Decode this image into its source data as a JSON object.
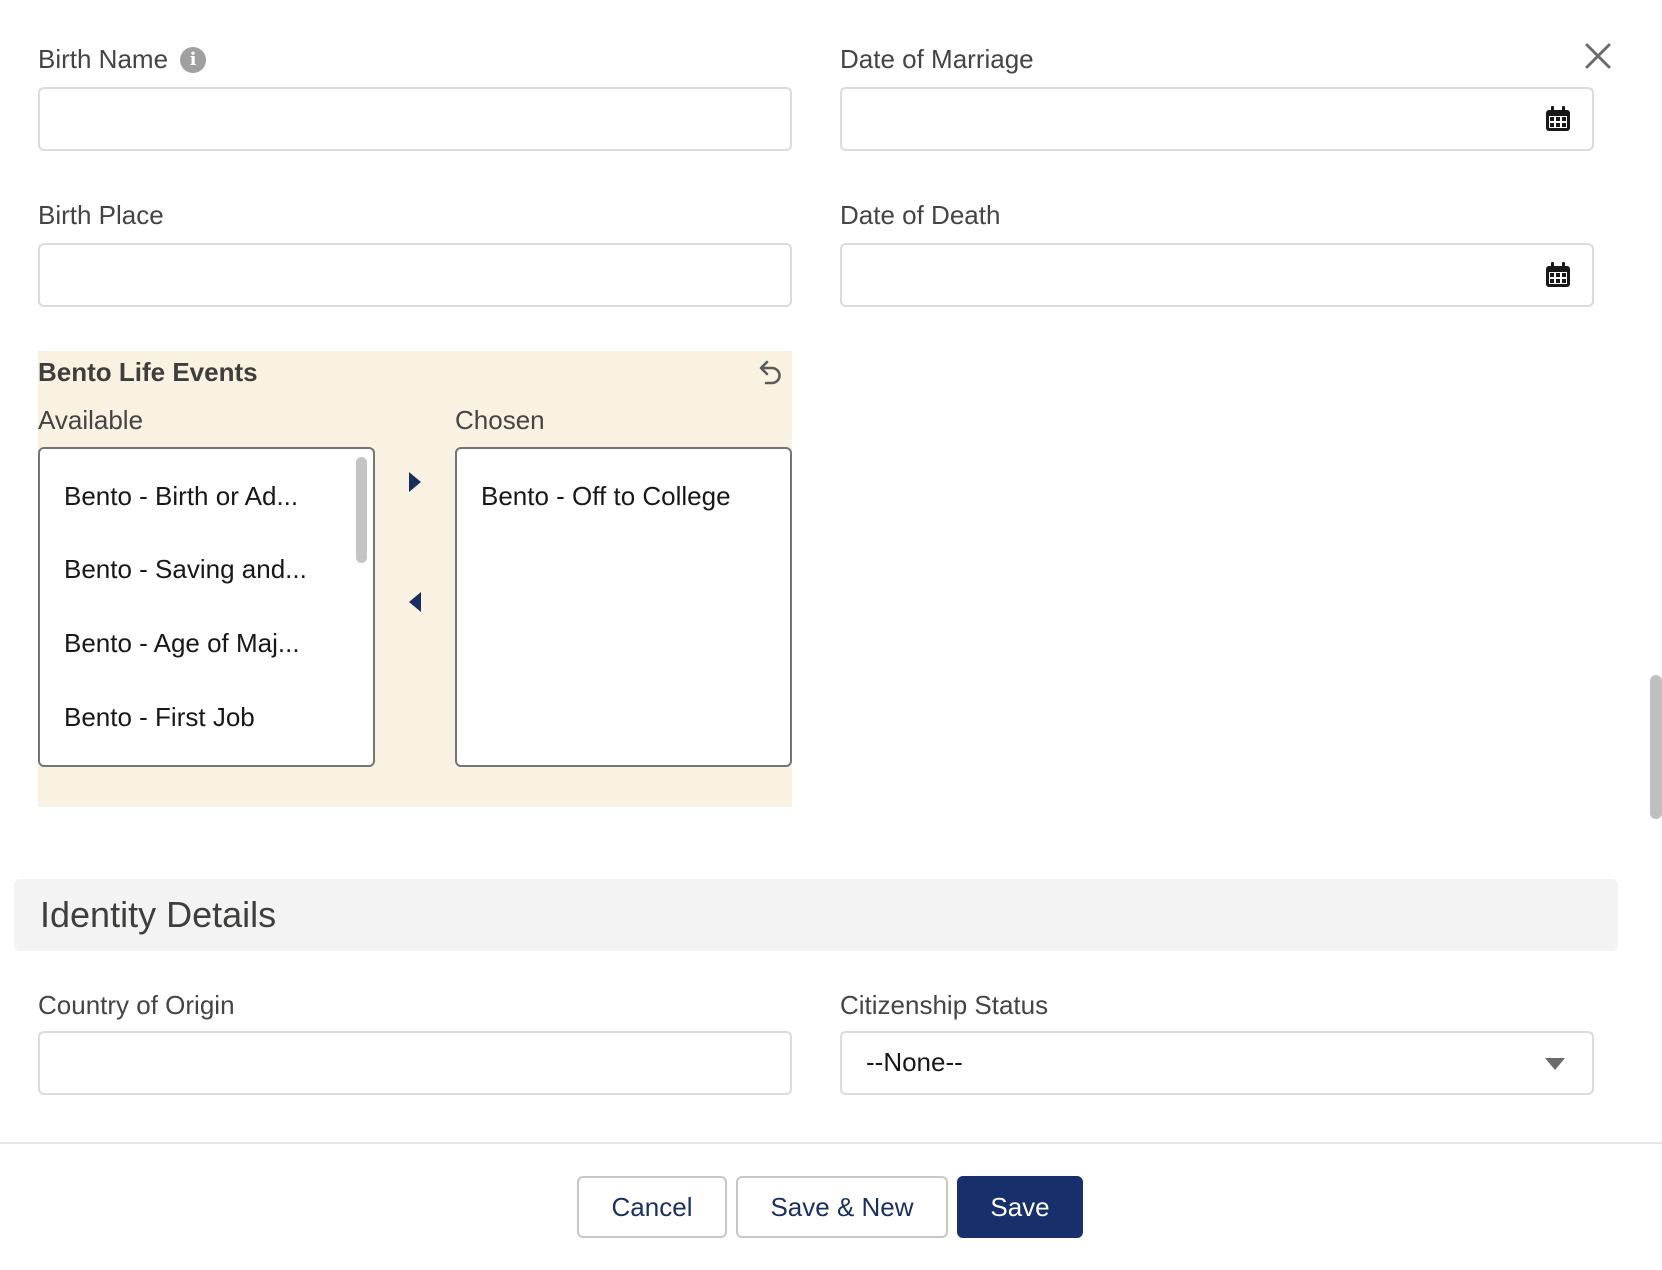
{
  "icons": {
    "close": "close-icon",
    "info": "info-icon",
    "calendar": "calendar-icon",
    "undo": "undo-icon",
    "move_right": "triangle-right-icon",
    "move_left": "triangle-left-icon",
    "dropdown": "caret-down-icon"
  },
  "colors": {
    "brand": "#172f6a",
    "panel_bg": "#f9f2e2",
    "section_bg": "#f3f3f3",
    "arrow": "#1b2f5e"
  },
  "fields": {
    "birth_name": {
      "label": "Birth Name",
      "info_glyph": "i",
      "value": ""
    },
    "date_of_marriage": {
      "label": "Date of Marriage",
      "value": ""
    },
    "birth_place": {
      "label": "Birth Place",
      "value": ""
    },
    "date_of_death": {
      "label": "Date of Death",
      "value": ""
    }
  },
  "life_events": {
    "title": "Bento Life Events",
    "available_label": "Available",
    "chosen_label": "Chosen",
    "available": [
      "Bento - Birth or Ad...",
      "Bento - Saving and...",
      "Bento - Age of Maj...",
      "Bento - First Job"
    ],
    "chosen": [
      "Bento - Off to College"
    ]
  },
  "identity": {
    "section_title": "Identity Details",
    "country_of_origin": {
      "label": "Country of Origin",
      "value": ""
    },
    "citizenship_status": {
      "label": "Citizenship Status",
      "value": "--None--"
    }
  },
  "footer": {
    "cancel": "Cancel",
    "save_new": "Save & New",
    "save": "Save"
  }
}
